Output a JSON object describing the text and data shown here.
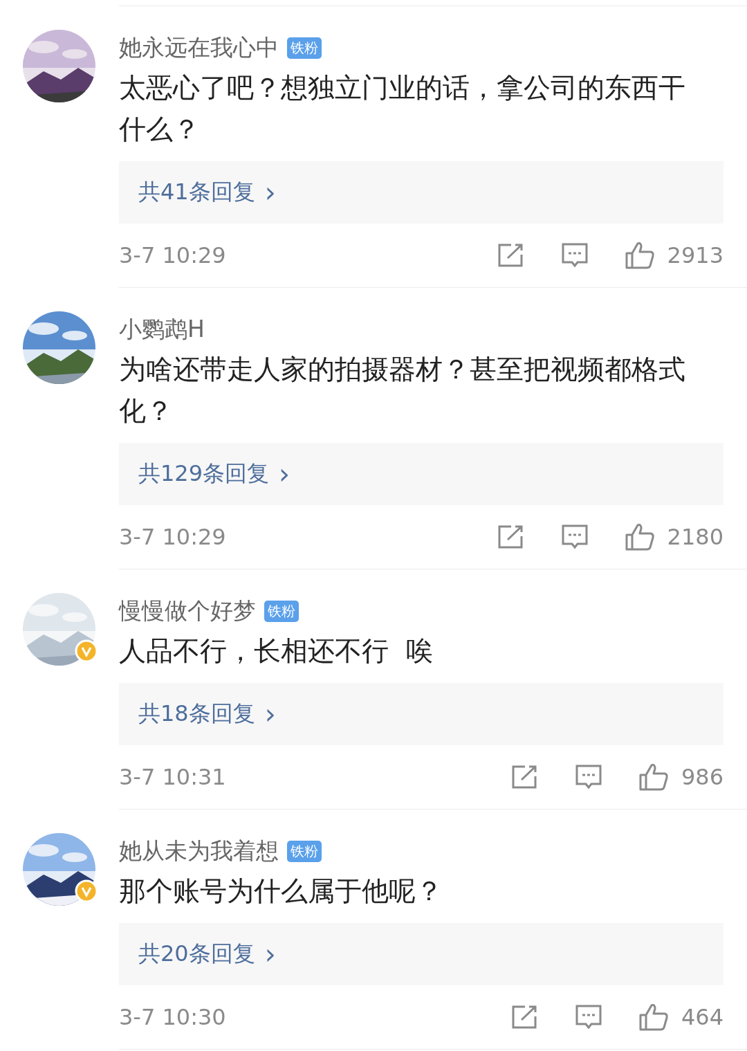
{
  "comments": [
    {
      "verified": false,
      "name": "她永远在我心中",
      "badge": "铁粉",
      "text": "太恶心了吧？想独立门业的话，拿公司的东西干什么？",
      "replies": "共41条回复",
      "chevron": "›",
      "time": "3-7 10:29",
      "likes": "2913"
    },
    {
      "verified": false,
      "name": "小鹦鹉H",
      "text": "为啥还带走人家的拍摄器材？甚至把视频都格式化？",
      "replies": "共129条回复",
      "chevron": "›",
      "time": "3-7 10:29",
      "likes": "2180"
    },
    {
      "verified": true,
      "name": "慢慢做个好梦",
      "badge": "铁粉",
      "text": "人品不行，长相还不行  唉",
      "replies": "共18条回复",
      "chevron": "›",
      "time": "3-7 10:31",
      "likes": "986"
    },
    {
      "verified": true,
      "name": "她从未为我着想",
      "badge": "铁粉",
      "text": "那个账号为什么属于他呢？",
      "replies": "共20条回复",
      "chevron": "›",
      "time": "3-7 10:30",
      "likes": "464"
    }
  ]
}
